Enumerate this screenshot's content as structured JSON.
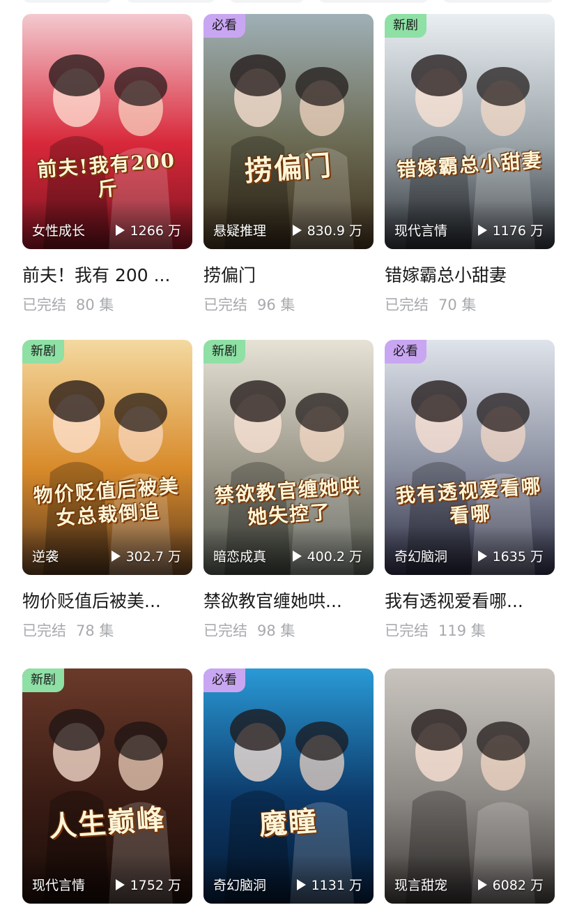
{
  "colors": {
    "badge_new": "#8ee0a5",
    "badge_must": "#c9a6f2",
    "title_text": "#1a1a1a",
    "meta_text": "#a7a9ad"
  },
  "icons": {
    "play": "play-icon"
  },
  "cards": [
    {
      "badge": "",
      "badge_type": "none",
      "genre": "女性成长",
      "views": "1266 万",
      "title": "前夫！我有 200 ...",
      "status": "已完结",
      "episodes": "80 集",
      "poster_text": "前夫!我有200斤",
      "palette": [
        "#f3c9cf",
        "#d8283a",
        "#7a1420"
      ]
    },
    {
      "badge": "必看",
      "badge_type": "must",
      "genre": "悬疑推理",
      "views": "830.9 万",
      "title": "捞偏门",
      "status": "已完结",
      "episodes": "96 集",
      "poster_text": "捞偏门",
      "palette": [
        "#9fb0b6",
        "#6b6a52",
        "#3a2c1a"
      ]
    },
    {
      "badge": "新剧",
      "badge_type": "new",
      "genre": "现代言情",
      "views": "1176 万",
      "title": "错嫁霸总小甜妻",
      "status": "已完结",
      "episodes": "70 集",
      "poster_text": "错嫁霸总小甜妻",
      "palette": [
        "#e9eef2",
        "#9aa3a8",
        "#2b2f35"
      ]
    },
    {
      "badge": "新剧",
      "badge_type": "new",
      "genre": "逆袭",
      "views": "302.7 万",
      "title": "物价贬值后被美...",
      "status": "已完结",
      "episodes": "78 集",
      "poster_text": "物价贬值后被美女总裁倒追",
      "palette": [
        "#f4d9a0",
        "#d88a2a",
        "#5a3a20"
      ]
    },
    {
      "badge": "新剧",
      "badge_type": "new",
      "genre": "暗恋成真",
      "views": "400.2 万",
      "title": "禁欲教官缠她哄...",
      "status": "已完结",
      "episodes": "98 集",
      "poster_text": "禁欲教官缠她哄她失控了",
      "palette": [
        "#e6e2d6",
        "#9a9688",
        "#4a5048"
      ]
    },
    {
      "badge": "必看",
      "badge_type": "must",
      "genre": "奇幻脑洞",
      "views": "1635 万",
      "title": "我有透视爱看哪...",
      "status": "已完结",
      "episodes": "119 集",
      "poster_text": "我有透视爱看哪看哪",
      "palette": [
        "#dfe3ea",
        "#8a8fa0",
        "#2a2a40"
      ]
    },
    {
      "badge": "新剧",
      "badge_type": "new",
      "genre": "现代言情",
      "views": "1752 万",
      "title": "",
      "status": "",
      "episodes": "",
      "poster_text": "人生巅峰",
      "palette": [
        "#6a3a2a",
        "#3a1c14",
        "#1a0c08"
      ]
    },
    {
      "badge": "必看",
      "badge_type": "must",
      "genre": "奇幻脑洞",
      "views": "1131 万",
      "title": "",
      "status": "",
      "episodes": "",
      "poster_text": "魔瞳",
      "palette": [
        "#2a9ad6",
        "#0c3a6a",
        "#061a34"
      ]
    },
    {
      "badge": "",
      "badge_type": "none",
      "genre": "现言甜宠",
      "views": "6082 万",
      "title": "",
      "status": "",
      "episodes": "",
      "poster_text": "",
      "palette": [
        "#c9c4be",
        "#8d8a86",
        "#3a3634"
      ]
    }
  ]
}
